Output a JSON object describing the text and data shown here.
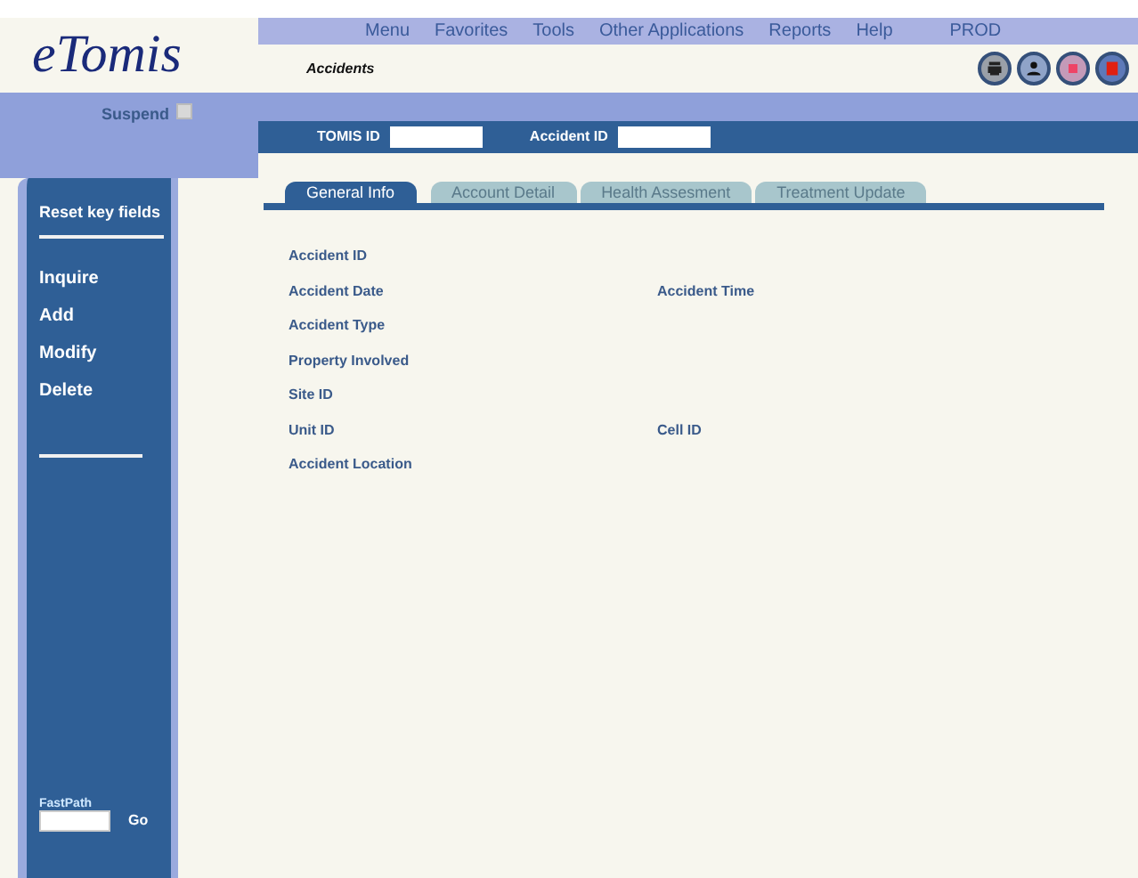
{
  "logo": "eTomis",
  "menu": [
    "Menu",
    "Favorites",
    "Tools",
    "Other Applications",
    "Reports",
    "Help"
  ],
  "environment": "PROD",
  "page_title": "Accidents",
  "suspend": {
    "label": "Suspend",
    "checked": false
  },
  "key_fields": [
    {
      "label": "TOMIS ID"
    },
    {
      "label": "Accident ID"
    }
  ],
  "sidebar": {
    "reset": "Reset key fields",
    "actions": [
      "Inquire",
      "Add",
      "Modify",
      "Delete"
    ]
  },
  "fastpath": {
    "label": "FastPath",
    "button": "Go"
  },
  "tabs": [
    {
      "label": "General Info",
      "selected": true
    },
    {
      "label": "Account Detail",
      "selected": false
    },
    {
      "label": "Health Assesment",
      "selected": false
    },
    {
      "label": "Treatment Update",
      "selected": false
    }
  ],
  "form_rows": [
    [
      "Accident ID"
    ],
    [
      "Accident Date",
      "Accident Time"
    ],
    [
      "Accident Type"
    ],
    [
      "Property Involved"
    ],
    [
      "Site ID"
    ],
    [
      "Unit ID",
      "Cell ID"
    ],
    [
      "Accident Location"
    ]
  ]
}
